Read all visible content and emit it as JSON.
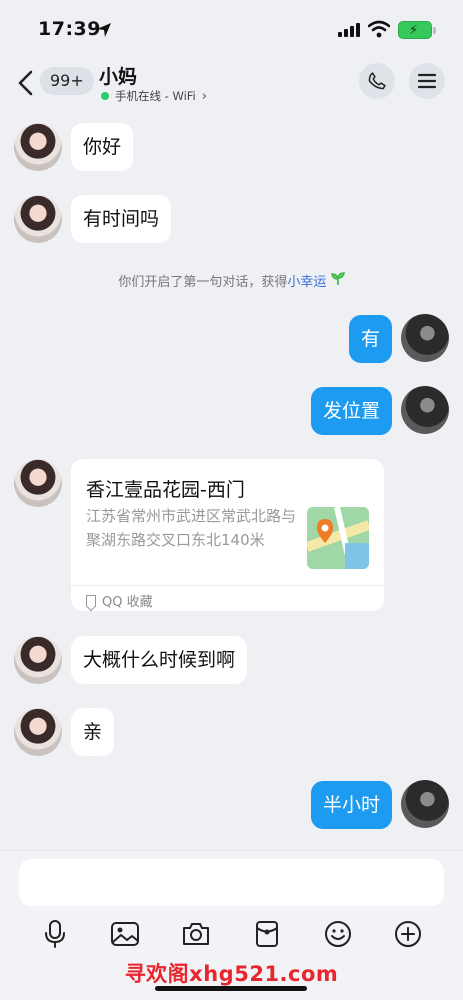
{
  "status_bar": {
    "time": "17:39"
  },
  "header": {
    "unread_count": "99+",
    "contact_name": "小妈",
    "presence": "手机在线 - WiFi"
  },
  "messages": [
    {
      "side": "in",
      "type": "text",
      "text": "你好"
    },
    {
      "side": "in",
      "type": "text",
      "text": "有时间吗"
    },
    {
      "type": "system",
      "text": "你们开启了第一句对话，获得",
      "link": "小幸运"
    },
    {
      "side": "out",
      "type": "text",
      "text": "有"
    },
    {
      "side": "out",
      "type": "text",
      "text": "发位置"
    },
    {
      "side": "in",
      "type": "location",
      "title": "香江壹品花园-西门",
      "address": "江苏省常州市武进区常武北路与聚湖东路交叉口东北140米",
      "footer": "QQ 收藏"
    },
    {
      "side": "in",
      "type": "text",
      "text": "大概什么时候到啊"
    },
    {
      "side": "in",
      "type": "text",
      "text": "亲"
    },
    {
      "side": "out",
      "type": "text",
      "text": "半小时"
    }
  ],
  "composer": {
    "placeholder": ""
  },
  "toolbar": {
    "icons": [
      "microphone-icon",
      "image-icon",
      "camera-icon",
      "red-packet-icon",
      "emoji-icon",
      "plus-icon"
    ]
  },
  "watermark": "寻欢阁xhg521.com",
  "colors": {
    "accent": "#1d9bf0",
    "online": "#2ecc71",
    "watermark": "#e8262e"
  }
}
